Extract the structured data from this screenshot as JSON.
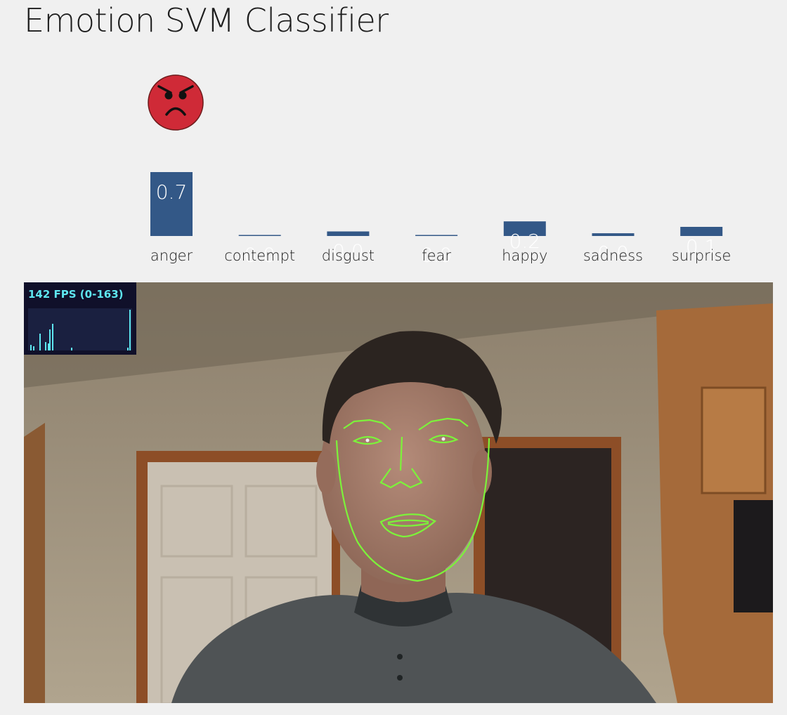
{
  "page": {
    "title": "Emotion SVM Classifier",
    "predicted_emotion_icon": "angry-face-icon"
  },
  "fps": {
    "label": "142 FPS (0-163)"
  },
  "colors": {
    "bar": "#335887",
    "emoji_face": "#cf2a37",
    "fps_text": "#5ee6f0",
    "face_mesh": "#7cf33a"
  },
  "chart_data": {
    "type": "bar",
    "categories": [
      "anger",
      "contempt",
      "disgust",
      "fear",
      "happy",
      "sadness",
      "surprise"
    ],
    "values": [
      0.7,
      0.01,
      0.05,
      0.01,
      0.16,
      0.03,
      0.1
    ],
    "value_labels": [
      "0.7",
      "0.0",
      "0.0",
      "0.0",
      "0.2",
      "0.0",
      "0.1"
    ],
    "ylim": [
      0,
      1
    ]
  }
}
